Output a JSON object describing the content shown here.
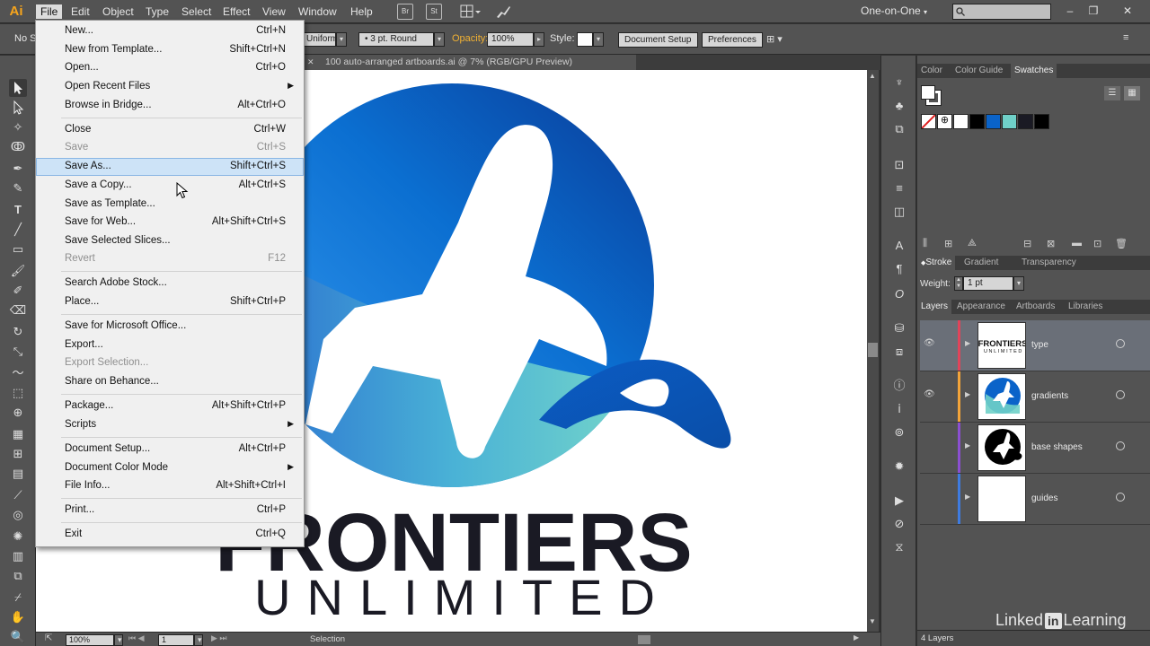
{
  "app": {
    "logo": "Ai"
  },
  "menubar": {
    "items": [
      "File",
      "Edit",
      "Object",
      "Type",
      "Select",
      "Effect",
      "View",
      "Window",
      "Help"
    ],
    "bridge_icon": "Br",
    "stock_icon": "St",
    "workspace": "One-on-One",
    "win_min": "–",
    "win_max": "❐",
    "win_close": "✕"
  },
  "controlbar": {
    "selection": "No S",
    "profile": "Uniform",
    "brush": "3 pt. Round",
    "opacity_label": "Opacity:",
    "opacity_value": "100%",
    "style_label": "Style:",
    "doc_setup": "Document Setup",
    "preferences": "Preferences"
  },
  "document": {
    "tab_title": "100 auto-arranged artboards.ai @ 7% (RGB/GPU Preview)",
    "close_glyph": "✕"
  },
  "artwork": {
    "title_line1": "FRONTIERS",
    "title_line2": "UNLIMITED"
  },
  "statusbar": {
    "zoom": "100%",
    "artboard": "1",
    "tool": "Selection"
  },
  "panels": {
    "swatch_tabs": [
      "Color",
      "Color Guide",
      "Swatches"
    ],
    "stroke_tabs": [
      "Stroke",
      "Gradient",
      "Transparency"
    ],
    "weight_label": "Weight:",
    "weight_value": "1 pt",
    "layer_tabs": [
      "Layers",
      "Appearance",
      "Artboards",
      "Libraries"
    ],
    "layers": [
      {
        "name": "type",
        "color": "#e0445a"
      },
      {
        "name": "gradients",
        "color": "#f3a43a"
      },
      {
        "name": "base shapes",
        "color": "#8b4fd1"
      },
      {
        "name": "guides",
        "color": "#3e7be0"
      }
    ],
    "layer_count": "4 Layers",
    "thumb_type_line1": "FRONTIERS",
    "thumb_type_line2": "UNLIMITED"
  },
  "watermark": {
    "pre": "Linked",
    "in": "in",
    "post": "Learning"
  },
  "file_menu": {
    "items": [
      {
        "label": "New...",
        "shortcut": "Ctrl+N"
      },
      {
        "label": "New from Template...",
        "shortcut": "Shift+Ctrl+N"
      },
      {
        "label": "Open...",
        "shortcut": "Ctrl+O"
      },
      {
        "label": "Open Recent Files",
        "shortcut": ""
      },
      {
        "label": "Browse in Bridge...",
        "shortcut": "Alt+Ctrl+O"
      },
      {
        "label": "Close",
        "shortcut": "Ctrl+W"
      },
      {
        "label": "Save",
        "shortcut": "Ctrl+S"
      },
      {
        "label": "Save As...",
        "shortcut": "Shift+Ctrl+S"
      },
      {
        "label": "Save a Copy...",
        "shortcut": "Alt+Ctrl+S"
      },
      {
        "label": "Save as Template...",
        "shortcut": ""
      },
      {
        "label": "Save for Web...",
        "shortcut": "Alt+Shift+Ctrl+S"
      },
      {
        "label": "Save Selected Slices...",
        "shortcut": ""
      },
      {
        "label": "Revert",
        "shortcut": "F12"
      },
      {
        "label": "Search Adobe Stock...",
        "shortcut": ""
      },
      {
        "label": "Place...",
        "shortcut": "Shift+Ctrl+P"
      },
      {
        "label": "Save for Microsoft Office...",
        "shortcut": ""
      },
      {
        "label": "Export...",
        "shortcut": ""
      },
      {
        "label": "Export Selection...",
        "shortcut": ""
      },
      {
        "label": "Share on Behance...",
        "shortcut": ""
      },
      {
        "label": "Package...",
        "shortcut": "Alt+Shift+Ctrl+P"
      },
      {
        "label": "Scripts",
        "shortcut": ""
      },
      {
        "label": "Document Setup...",
        "shortcut": "Alt+Ctrl+P"
      },
      {
        "label": "Document Color Mode",
        "shortcut": ""
      },
      {
        "label": "File Info...",
        "shortcut": "Alt+Shift+Ctrl+I"
      },
      {
        "label": "Print...",
        "shortcut": "Ctrl+P"
      },
      {
        "label": "Exit",
        "shortcut": "Ctrl+Q"
      }
    ]
  },
  "colors": {
    "brand_blue": "#0a63c9",
    "teal": "#6fd0c8",
    "dark_text": "#1a1a24",
    "menu_highlight": "#cde3f7"
  }
}
